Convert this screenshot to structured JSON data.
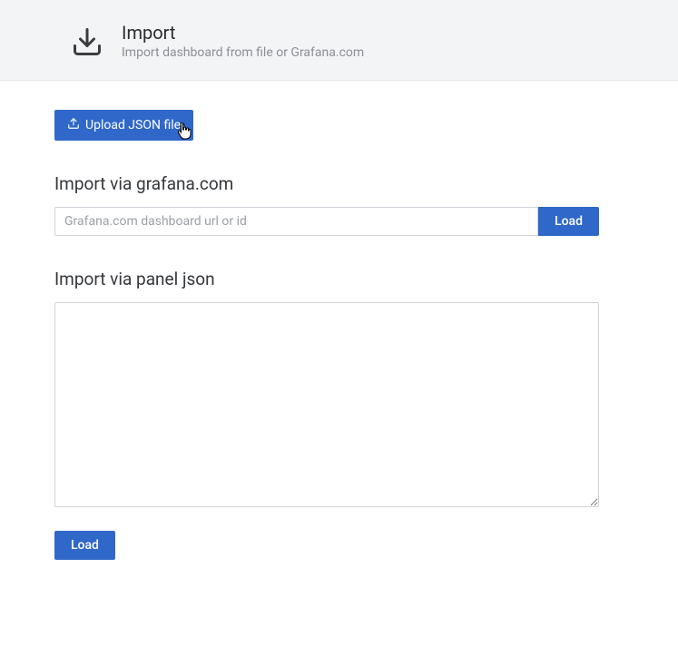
{
  "header": {
    "title": "Import",
    "subtitle": "Import dashboard from file or Grafana.com"
  },
  "upload": {
    "button_label": "Upload JSON file"
  },
  "grafana_section": {
    "title": "Import via grafana.com",
    "input_placeholder": "Grafana.com dashboard url or id",
    "input_value": "",
    "load_label": "Load"
  },
  "json_section": {
    "title": "Import via panel json",
    "textarea_value": "",
    "load_label": "Load"
  }
}
